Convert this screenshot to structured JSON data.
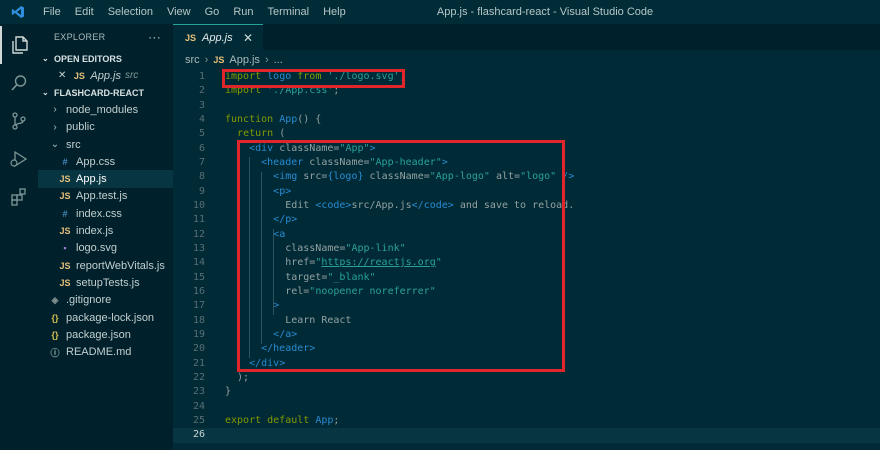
{
  "titlebar": {
    "menu": [
      "File",
      "Edit",
      "Selection",
      "View",
      "Go",
      "Run",
      "Terminal",
      "Help"
    ],
    "window_title": "App.js - flashcard-react - Visual Studio Code"
  },
  "activity_icons": [
    "files-icon",
    "search-icon",
    "source-control-icon",
    "run-debug-icon",
    "extensions-icon"
  ],
  "sidebar": {
    "header": "EXPLORER",
    "more": "···",
    "open_editors_label": "OPEN EDITORS",
    "open_editor": {
      "close": "✕",
      "name": "App.js",
      "folder": "src"
    },
    "project_label": "FLASHCARD-REACT",
    "tree": [
      {
        "name": "node_modules",
        "type": "folder",
        "depth": 1,
        "icon": "›"
      },
      {
        "name": "public",
        "type": "folder",
        "depth": 1,
        "icon": "›"
      },
      {
        "name": "src",
        "type": "folder-open",
        "depth": 1,
        "icon": "⌄"
      },
      {
        "name": "App.css",
        "type": "css",
        "depth": 2,
        "icon": "#"
      },
      {
        "name": "App.js",
        "type": "js",
        "depth": 2,
        "icon": "JS",
        "selected": true
      },
      {
        "name": "App.test.js",
        "type": "js",
        "depth": 2,
        "icon": "JS"
      },
      {
        "name": "index.css",
        "type": "css",
        "depth": 2,
        "icon": "#"
      },
      {
        "name": "index.js",
        "type": "js",
        "depth": 2,
        "icon": "JS"
      },
      {
        "name": "logo.svg",
        "type": "svg",
        "depth": 2,
        "icon": "▪"
      },
      {
        "name": "reportWebVitals.js",
        "type": "js",
        "depth": 2,
        "icon": "JS"
      },
      {
        "name": "setupTests.js",
        "type": "js",
        "depth": 2,
        "icon": "JS"
      },
      {
        "name": ".gitignore",
        "type": "git",
        "depth": 1,
        "icon": "◈"
      },
      {
        "name": "package-lock.json",
        "type": "json",
        "depth": 1,
        "icon": "{}"
      },
      {
        "name": "package.json",
        "type": "json",
        "depth": 1,
        "icon": "{}"
      },
      {
        "name": "README.md",
        "type": "info",
        "depth": 1,
        "icon": "ⓘ"
      }
    ]
  },
  "editor": {
    "tab": {
      "icon": "JS",
      "label": "App.js",
      "close": "✕"
    },
    "breadcrumb": {
      "folder": "src",
      "sep": "›",
      "icon": "JS",
      "file": "App.js",
      "more": "..."
    },
    "current_line": 26,
    "lines": [
      [
        [
          "kw",
          "import "
        ],
        [
          "tag",
          "logo "
        ],
        [
          "kw",
          "from "
        ],
        [
          "str",
          "'./logo.svg'"
        ],
        [
          "attr",
          ";"
        ]
      ],
      [
        [
          "kw",
          "import "
        ],
        [
          "str",
          "'./App.css'"
        ],
        [
          "attr",
          ";"
        ]
      ],
      [],
      [
        [
          "kw",
          "function "
        ],
        [
          "fn",
          "App"
        ],
        [
          "attr",
          "() {"
        ]
      ],
      [
        [
          "attr",
          "  "
        ],
        [
          "kw",
          "return "
        ],
        [
          "attr",
          "("
        ]
      ],
      [
        [
          "attr",
          "    "
        ],
        [
          "tag",
          "<div "
        ],
        [
          "attr",
          "className="
        ],
        [
          "str",
          "\"App\""
        ],
        [
          "tag",
          ">"
        ]
      ],
      [
        [
          "attr",
          "      "
        ],
        [
          "tag",
          "<header "
        ],
        [
          "attr",
          "className="
        ],
        [
          "str",
          "\"App-header\""
        ],
        [
          "tag",
          ">"
        ]
      ],
      [
        [
          "attr",
          "        "
        ],
        [
          "tag",
          "<img "
        ],
        [
          "attr",
          "src="
        ],
        [
          "tag",
          "{logo} "
        ],
        [
          "attr",
          "className="
        ],
        [
          "str",
          "\"App-logo\" "
        ],
        [
          "attr",
          "alt="
        ],
        [
          "str",
          "\"logo\" "
        ],
        [
          "tag",
          "/>"
        ]
      ],
      [
        [
          "attr",
          "        "
        ],
        [
          "tag",
          "<p>"
        ]
      ],
      [
        [
          "attr",
          "          Edit "
        ],
        [
          "tag",
          "<code>"
        ],
        [
          "attr",
          "src/App.js"
        ],
        [
          "tag",
          "</code>"
        ],
        [
          "attr",
          " and save to reload."
        ]
      ],
      [
        [
          "attr",
          "        "
        ],
        [
          "tag",
          "</p>"
        ]
      ],
      [
        [
          "attr",
          "        "
        ],
        [
          "tag",
          "<a"
        ]
      ],
      [
        [
          "attr",
          "          className="
        ],
        [
          "str",
          "\"App-link\""
        ]
      ],
      [
        [
          "attr",
          "          href="
        ],
        [
          "str",
          "\""
        ],
        [
          "link",
          "https://reactjs.org"
        ],
        [
          "str",
          "\""
        ]
      ],
      [
        [
          "attr",
          "          target="
        ],
        [
          "str",
          "\"_blank\""
        ]
      ],
      [
        [
          "attr",
          "          rel="
        ],
        [
          "str",
          "\"noopener noreferrer\""
        ]
      ],
      [
        [
          "attr",
          "        "
        ],
        [
          "tag",
          ">"
        ]
      ],
      [
        [
          "attr",
          "          Learn React"
        ]
      ],
      [
        [
          "attr",
          "        "
        ],
        [
          "tag",
          "</a>"
        ]
      ],
      [
        [
          "attr",
          "      "
        ],
        [
          "tag",
          "</header>"
        ]
      ],
      [
        [
          "attr",
          "    "
        ],
        [
          "tag",
          "</div>"
        ]
      ],
      [
        [
          "attr",
          "  );"
        ]
      ],
      [
        [
          "attr",
          "}"
        ]
      ],
      [],
      [
        [
          "kw",
          "export default "
        ],
        [
          "fn",
          "App"
        ],
        [
          "attr",
          ";"
        ]
      ],
      []
    ]
  },
  "colors": {
    "background": "#002b36",
    "sidebar": "#00212b",
    "highlight_box": "#e0262b",
    "keyword": "#859900",
    "string": "#2aa198",
    "tag": "#268bd2"
  }
}
